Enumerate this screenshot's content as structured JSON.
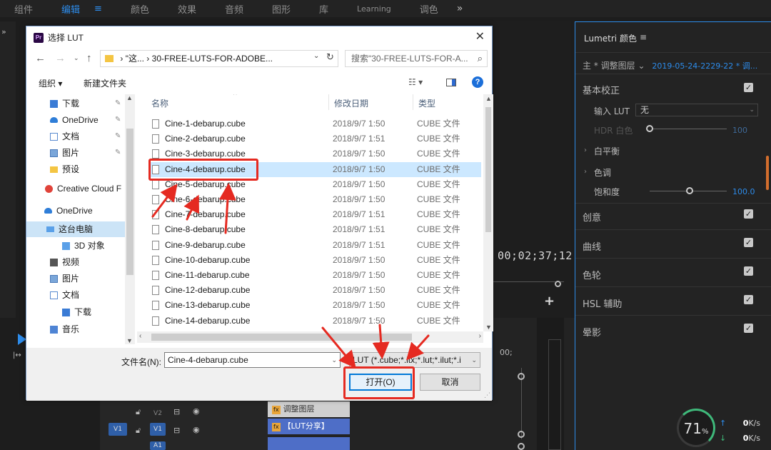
{
  "workspace_tabs": [
    "组件",
    "编辑",
    "颜色",
    "效果",
    "音频",
    "图形",
    "库",
    "Learning",
    "调色"
  ],
  "workspace_active_index": 1,
  "workspace_more": "»",
  "program_monitor": {
    "timecode": "00;02;37;12"
  },
  "timeline": {
    "tracks": [
      "V2",
      "V1",
      "A1"
    ],
    "source_patch": "V1",
    "clips": {
      "adjustment": "调整图层",
      "lut_share": "【LUT分享】"
    },
    "fx_badge": "fx",
    "right_timecode": "00;"
  },
  "lumetri": {
    "title": "Lumetri 颜色",
    "menu_icon": "≡",
    "source_prefix": "主 * 调整图层",
    "source_select": "2019-05-24-2229-22 * 调...",
    "sections": {
      "basic": "基本校正",
      "input_lut_label": "输入 LUT",
      "input_lut_value": "无",
      "hdr_white": "HDR 白色",
      "hdr_value": "100",
      "white_balance": "白平衡",
      "tone": "色调",
      "saturation": "饱和度",
      "saturation_value": "100.0",
      "creative": "创意",
      "curves": "曲线",
      "color_wheels": "色轮",
      "hsl": "HSL 辅助",
      "vignette": "晕影"
    }
  },
  "system_monitor": {
    "cpu_percent": "71",
    "pct_sign": "%",
    "upload": "0",
    "download": "0",
    "unit": "K/s"
  },
  "dialog": {
    "title": "选择 LUT",
    "close": "✕",
    "address": {
      "path_prefix": "\"这...",
      "sep": "›",
      "current": "30-FREE-LUTS-FOR-ADOBE..."
    },
    "search_placeholder": "搜索\"30-FREE-LUTS-FOR-A...",
    "toolbar": {
      "organize": "组织 ▾",
      "new_folder": "新建文件夹",
      "view": "☷ ▾",
      "help": "?"
    },
    "nav_items": [
      {
        "label": "下载",
        "icon": "download-icon",
        "pinned": true
      },
      {
        "label": "OneDrive",
        "icon": "onedrive-icon",
        "pinned": true
      },
      {
        "label": "文档",
        "icon": "document-icon",
        "pinned": true
      },
      {
        "label": "图片",
        "icon": "picture-icon",
        "pinned": true
      },
      {
        "label": "预设",
        "icon": "folder-icon",
        "pinned": false
      },
      {
        "label": "Creative Cloud F",
        "icon": "creative-cloud-icon",
        "pinned": false
      },
      {
        "label": "OneDrive",
        "icon": "onedrive-icon",
        "pinned": false
      },
      {
        "label": "这台电脑",
        "icon": "computer-icon",
        "pinned": false,
        "selected": true
      },
      {
        "label": "3D 对象",
        "icon": "3d-objects-icon",
        "pinned": false
      },
      {
        "label": "视频",
        "icon": "video-icon",
        "pinned": false
      },
      {
        "label": "图片",
        "icon": "picture-icon",
        "pinned": false
      },
      {
        "label": "文档",
        "icon": "document-icon",
        "pinned": false
      },
      {
        "label": "下载",
        "icon": "download-icon",
        "pinned": false
      },
      {
        "label": "音乐",
        "icon": "music-icon",
        "pinned": false
      }
    ],
    "columns": {
      "name": "名称",
      "modified": "修改日期",
      "type": "类型"
    },
    "files": [
      {
        "name": "Cine-1-debarup.cube",
        "date": "2018/9/7 1:50",
        "type": "CUBE 文件"
      },
      {
        "name": "Cine-2-debarup.cube",
        "date": "2018/9/7 1:51",
        "type": "CUBE 文件"
      },
      {
        "name": "Cine-3-debarup.cube",
        "date": "2018/9/7 1:50",
        "type": "CUBE 文件"
      },
      {
        "name": "Cine-4-debarup.cube",
        "date": "2018/9/7 1:50",
        "type": "CUBE 文件",
        "selected": true
      },
      {
        "name": "Cine-5-debarup.cube",
        "date": "2018/9/7 1:50",
        "type": "CUBE 文件"
      },
      {
        "name": "Cine-6-debarup.cube",
        "date": "2018/9/7 1:50",
        "type": "CUBE 文件"
      },
      {
        "name": "Cine-7-debarup.cube",
        "date": "2018/9/7 1:51",
        "type": "CUBE 文件"
      },
      {
        "name": "Cine-8-debarup.cube",
        "date": "2018/9/7 1:51",
        "type": "CUBE 文件"
      },
      {
        "name": "Cine-9-debarup.cube",
        "date": "2018/9/7 1:51",
        "type": "CUBE 文件"
      },
      {
        "name": "Cine-10-debarup.cube",
        "date": "2018/9/7 1:50",
        "type": "CUBE 文件"
      },
      {
        "name": "Cine-11-debarup.cube",
        "date": "2018/9/7 1:50",
        "type": "CUBE 文件"
      },
      {
        "name": "Cine-12-debarup.cube",
        "date": "2018/9/7 1:50",
        "type": "CUBE 文件"
      },
      {
        "name": "Cine-13-debarup.cube",
        "date": "2018/9/7 1:50",
        "type": "CUBE 文件"
      },
      {
        "name": "Cine-14-debarup.cube",
        "date": "2018/9/7 1:50",
        "type": "CUBE 文件"
      }
    ],
    "filename_label": "文件名(N):",
    "filename_value": "Cine-4-debarup.cube",
    "filter_value": "LUT (*.cube;*.itx;*.lut;*.ilut;*.i",
    "open_button": "打开(O)",
    "cancel_button": "取消"
  },
  "colors": {
    "accent_blue": "#2d8ceb",
    "annotation_red": "#e52a21",
    "selection_blue": "#cce8ff"
  }
}
